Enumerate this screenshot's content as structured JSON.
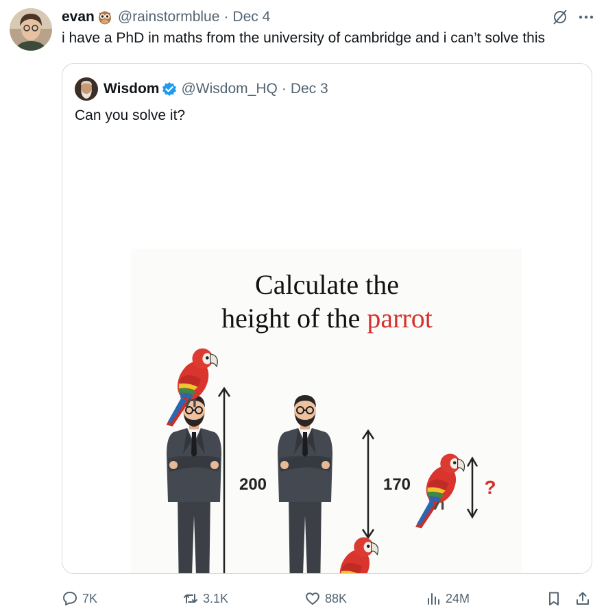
{
  "tweet": {
    "author_name": "evan",
    "author_emoji_icon": "owl-icon",
    "handle": "@rainstormblue",
    "separator": "·",
    "date": "Dec 4",
    "text": "i have a PhD in maths from the university of cambridge and i can’t solve this"
  },
  "quoted": {
    "author_name": "Wisdom",
    "verified_icon": "verified-badge-icon",
    "handle": "@Wisdom_HQ",
    "separator": "·",
    "date": "Dec 3",
    "text": "Can you solve it?",
    "image": {
      "title_line1": "Calculate the",
      "title_line2_prefix": "height of the ",
      "title_line2_highlight": "parrot",
      "label_left": "200",
      "label_middle": "170",
      "label_question": "?",
      "highlight_color": "#d6312c"
    }
  },
  "actions": {
    "replies": "7K",
    "reposts": "3.1K",
    "likes": "88K",
    "views": "24M"
  },
  "colors": {
    "text": "#0f1419",
    "muted": "#536471",
    "border": "#cfd9de",
    "verified": "#1d9bf0"
  }
}
